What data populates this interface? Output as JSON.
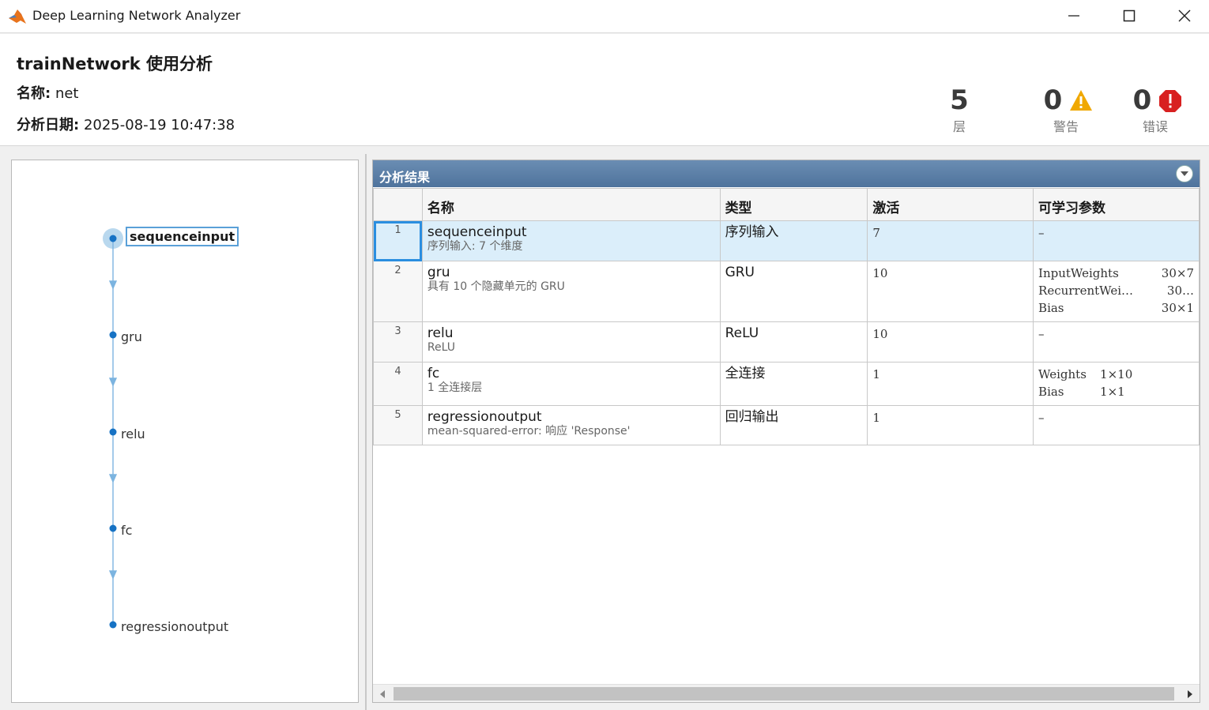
{
  "window": {
    "title": "Deep Learning Network Analyzer",
    "app_icon": "matlab-icon",
    "controls": {
      "minimize": "minimize-icon",
      "maximize": "maximize-icon",
      "close": "close-icon"
    }
  },
  "header": {
    "title": "trainNetwork 使用分析",
    "name_label": "名称:",
    "name_value": "net",
    "date_label": "分析日期:",
    "date_value": "2025-08-19 10:47:38"
  },
  "stats": {
    "layers": {
      "count": "5",
      "label": "层"
    },
    "warnings": {
      "count": "0",
      "label": "警告",
      "icon": "warning-icon",
      "color": "#f0a800"
    },
    "errors": {
      "count": "0",
      "label": "错误",
      "icon": "error-icon",
      "color": "#d82020"
    }
  },
  "graph": {
    "nodes": [
      "sequenceinput",
      "gru",
      "relu",
      "fc",
      "regressionoutput"
    ],
    "selected": 0,
    "edge_color": "#7cb4e0",
    "node_color": "#1672c4"
  },
  "results": {
    "title": "分析结果",
    "columns": [
      "",
      "名称",
      "类型",
      "激活",
      "可学习参数"
    ],
    "rows": [
      {
        "index": "1",
        "name": "sequenceinput",
        "desc": "序列输入: 7 个维度",
        "type": "序列输入",
        "activation": "7",
        "params": [
          [
            "–",
            ""
          ]
        ]
      },
      {
        "index": "2",
        "name": "gru",
        "desc": "具有 10 个隐藏单元的 GRU",
        "type": "GRU",
        "activation": "10",
        "params": [
          [
            "InputWeights",
            "30×7"
          ],
          [
            "RecurrentWei…",
            "30…"
          ],
          [
            "Bias",
            "30×1"
          ]
        ]
      },
      {
        "index": "3",
        "name": "relu",
        "desc": "ReLU",
        "type": "ReLU",
        "activation": "10",
        "params": [
          [
            "–",
            ""
          ]
        ]
      },
      {
        "index": "4",
        "name": "fc",
        "desc": "1 全连接层",
        "type": "全连接",
        "activation": "1",
        "params": [
          [
            "Weights",
            "1×10"
          ],
          [
            "Bias",
            "1×1"
          ]
        ]
      },
      {
        "index": "5",
        "name": "regressionoutput",
        "desc": "mean-squared-error: 响应 'Response'",
        "type": "回归输出",
        "activation": "1",
        "params": [
          [
            "–",
            ""
          ]
        ]
      }
    ]
  },
  "colors": {
    "panel_header": "#5b7fa8",
    "selection": "#dbeefa",
    "selection_border": "#2a8ee0"
  }
}
